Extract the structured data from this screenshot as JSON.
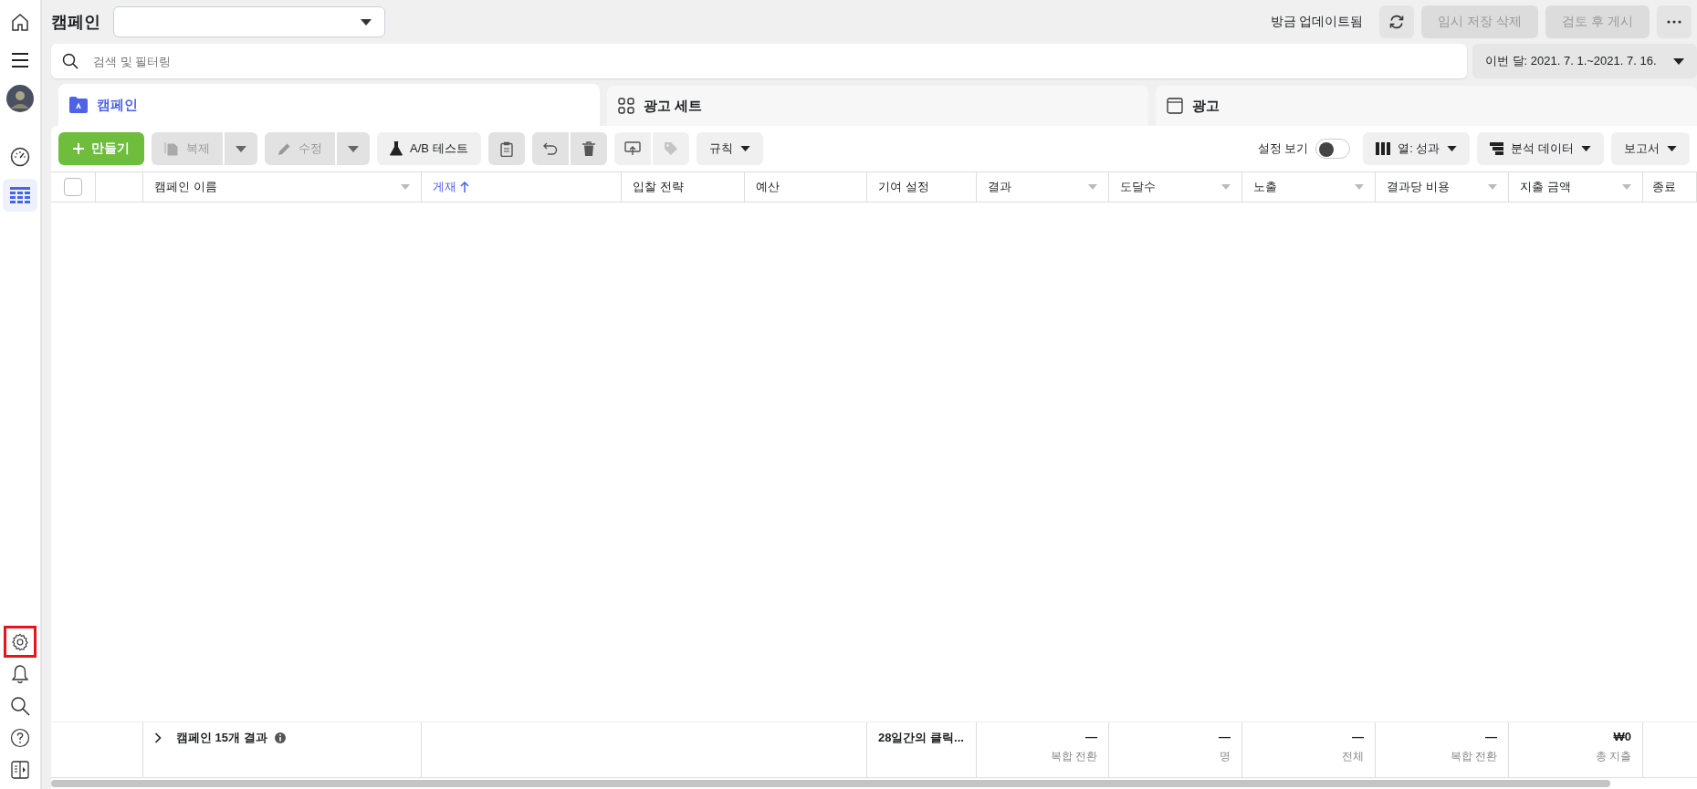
{
  "sidebar": {
    "top_items": [
      {
        "selected": false
      },
      {
        "selected": false
      },
      {
        "selected": false
      },
      {
        "selected": false
      },
      {
        "selected": true
      }
    ],
    "bottom_items": [
      {
        "highlighted": true
      },
      {
        "highlighted": false
      },
      {
        "highlighted": false
      },
      {
        "highlighted": false
      },
      {
        "highlighted": false
      }
    ]
  },
  "header": {
    "title": "캠페인",
    "status": "방금 업데이트됨",
    "buttons": [
      {
        "label": "임시 저장 삭제",
        "disabled": true
      },
      {
        "label": "검토 후 게시",
        "disabled": true
      }
    ]
  },
  "search": {
    "placeholder": "검색 및 필터링"
  },
  "date_range": "이번 달: 2021. 7. 1.~2021. 7. 16.",
  "tabs": [
    {
      "label": "캠페인",
      "selected": true
    },
    {
      "label": "광고 세트",
      "selected": false
    },
    {
      "label": "광고",
      "selected": false
    }
  ],
  "toolbar": {
    "create": "만들기",
    "duplicate": {
      "label": "복제",
      "disabled": true
    },
    "edit": {
      "label": "수정",
      "disabled": true
    },
    "ab_test": "A/B 테스트",
    "rules": "규칙",
    "view_setup": {
      "label": "설정 보기",
      "on": false
    },
    "columns": "열: 성과",
    "breakdown": "분석 데이터",
    "reports": "보고서"
  },
  "select_all": {
    "checked": false
  },
  "columns": [
    {
      "label": "캠페인 이름",
      "sorted": false,
      "has_menu": true
    },
    {
      "label": "게재",
      "sorted": true,
      "has_menu": false
    },
    {
      "label": "입찰 전략",
      "sorted": false,
      "has_menu": false
    },
    {
      "label": "예산",
      "sorted": false,
      "has_menu": false
    },
    {
      "label": "기여 설정",
      "sorted": false,
      "has_menu": false
    },
    {
      "label": "결과",
      "sorted": false,
      "has_menu": true
    },
    {
      "label": "도달수",
      "sorted": false,
      "has_menu": true
    },
    {
      "label": "노출",
      "sorted": false,
      "has_menu": true
    },
    {
      "label": "결과당 비용",
      "sorted": false,
      "has_menu": true
    },
    {
      "label": "지출 금액",
      "sorted": false,
      "has_menu": true
    },
    {
      "label": "종료",
      "sorted": false,
      "has_menu": false
    }
  ],
  "summary": {
    "label": "캠페인 15개 결과",
    "attribution": "28일간의 클릭...",
    "cells": [
      {
        "value": "—",
        "sub": "복합 전환"
      },
      {
        "value": "—",
        "sub": "명"
      },
      {
        "value": "—",
        "sub": "전체"
      },
      {
        "value": "—",
        "sub": "복합 전환"
      },
      {
        "value": "₩0",
        "sub": "총 지출"
      }
    ]
  }
}
